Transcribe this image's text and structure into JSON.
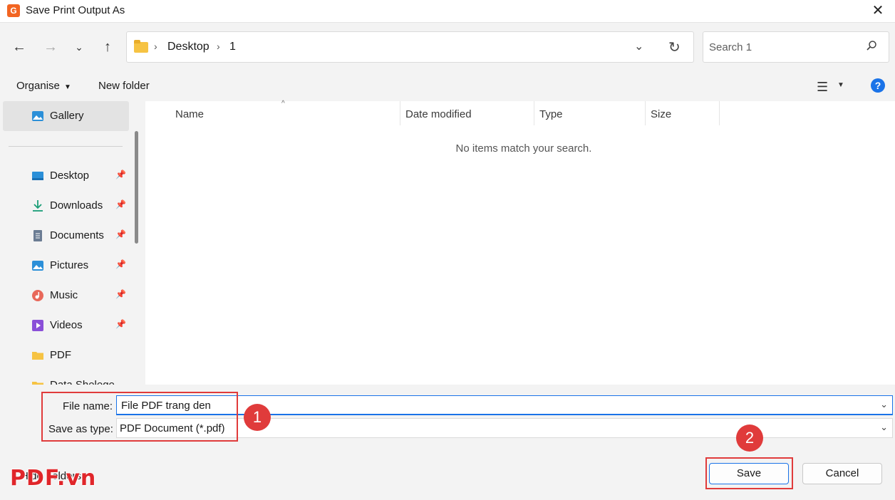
{
  "window": {
    "title": "Save Print Output As",
    "app_icon_glyph": "G"
  },
  "navbar": {
    "path": [
      "Desktop",
      "1"
    ],
    "search_placeholder": "Search 1"
  },
  "toolbar": {
    "organise": "Organise",
    "new_folder": "New folder",
    "help": "?"
  },
  "sidebar": {
    "gallery": "Gallery",
    "items": [
      {
        "label": "Desktop",
        "icon": "desktop-icon",
        "color": "#2b8fd8"
      },
      {
        "label": "Downloads",
        "icon": "download-icon",
        "color": "#1b9e77"
      },
      {
        "label": "Documents",
        "icon": "documents-icon",
        "color": "#6b7c93"
      },
      {
        "label": "Pictures",
        "icon": "pictures-icon",
        "color": "#2b8fd8"
      },
      {
        "label": "Music",
        "icon": "music-icon",
        "color": "#e8685a"
      },
      {
        "label": "Videos",
        "icon": "videos-icon",
        "color": "#8a4fd8"
      },
      {
        "label": "PDF",
        "icon": "folder-icon",
        "color": "#f6c343"
      },
      {
        "label": "Data Shelege",
        "icon": "folder-icon",
        "color": "#f6c343"
      }
    ]
  },
  "columns": [
    "Name",
    "Date modified",
    "Type",
    "Size"
  ],
  "empty_message": "No items match your search.",
  "form": {
    "file_name_label": "File name:",
    "file_name_value": "File PDF trang den",
    "save_type_label": "Save as type:",
    "save_type_value": "PDF Document (*.pdf)"
  },
  "annotations": {
    "one": "1",
    "two": "2"
  },
  "footer": {
    "hide_folders": "Hide Folders",
    "save": "Save",
    "cancel": "Cancel",
    "watermark": "PDF.vn"
  }
}
